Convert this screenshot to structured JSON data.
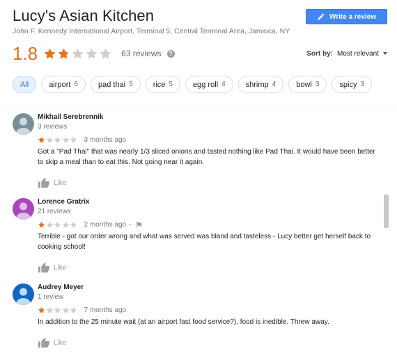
{
  "business": {
    "name": "Lucy's Asian Kitchen",
    "address": "John F. Kennedy International Airport, Terminal 5, Central Terminal Area, Jamaica, NY",
    "write_review_label": "Write a review"
  },
  "summary": {
    "rating": "1.8",
    "rating_value": 1.8,
    "stars_max": 5,
    "reviews_label": "63 reviews",
    "sort_label": "Sort by:",
    "sort_value": "Most relevant"
  },
  "chips": [
    {
      "label": "All",
      "count": ""
    },
    {
      "label": "airport",
      "count": "6"
    },
    {
      "label": "pad thai",
      "count": "5"
    },
    {
      "label": "rice",
      "count": "5"
    },
    {
      "label": "egg roll",
      "count": "4"
    },
    {
      "label": "shrimp",
      "count": "4"
    },
    {
      "label": "bowl",
      "count": "3"
    },
    {
      "label": "spicy",
      "count": "3"
    }
  ],
  "reviews": [
    {
      "name": "Mikhail Serebrennik",
      "meta": "3 reviews",
      "stars": 1,
      "time": "3 months ago",
      "text": "Got a \"Pad Thai\" that was nearly 1/3 sliced onions and tasted nothing like Pad Thai. It would have been better to skip a meal than to eat this. Not going near it again.",
      "like": "Like",
      "avatar_color": "#78909c"
    },
    {
      "name": "Lorence Gratrix",
      "meta": "21 reviews",
      "stars": 1,
      "time": "2 months ago",
      "dash": "-",
      "text": "Terrible - got our order wrong and what was served was bland and tasteless - Lucy better get herself back to cooking school!",
      "like": "Like",
      "avatar_color": "#ab47bc"
    },
    {
      "name": "Audrey Meyer",
      "meta": "1 review",
      "stars": 1,
      "time": "7 months ago",
      "text": "In addition to the 25 minute wait (at an airport fast food service?), food is inedible. Threw away.",
      "like": "Like",
      "avatar_color": "#1565c0"
    }
  ],
  "colors": {
    "star_filled": "#e7711b",
    "star_empty": "#cfcfcf",
    "accent": "#4285f4"
  }
}
